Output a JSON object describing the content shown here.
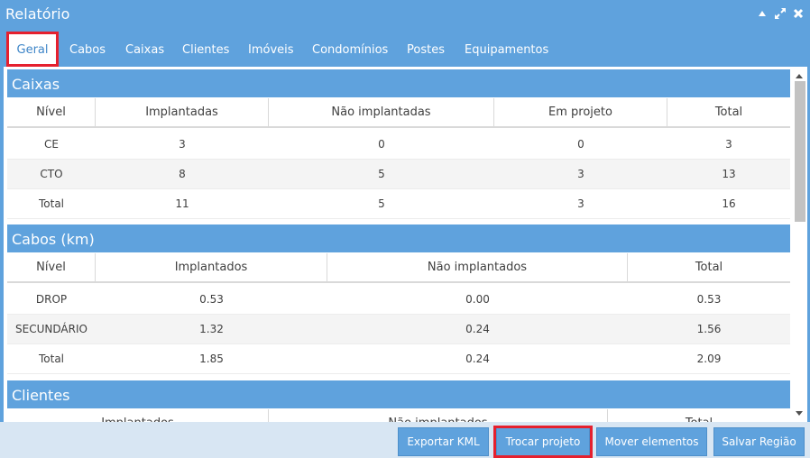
{
  "window": {
    "title": "Relatório"
  },
  "tabs": [
    {
      "label": "Geral",
      "active": true
    },
    {
      "label": "Cabos"
    },
    {
      "label": "Caixas"
    },
    {
      "label": "Clientes"
    },
    {
      "label": "Imóveis"
    },
    {
      "label": "Condomínios"
    },
    {
      "label": "Postes"
    },
    {
      "label": "Equipamentos"
    }
  ],
  "caixas": {
    "title": "Caixas",
    "headers": [
      "Nível",
      "Implantadas",
      "Não implantadas",
      "Em projeto",
      "Total"
    ],
    "rows": [
      [
        "CE",
        "3",
        "0",
        "0",
        "3"
      ],
      [
        "CTO",
        "8",
        "5",
        "3",
        "13"
      ],
      [
        "Total",
        "11",
        "5",
        "3",
        "16"
      ]
    ]
  },
  "cabos": {
    "title": "Cabos (km)",
    "headers": [
      "Nível",
      "Implantados",
      "Não implantados",
      "Total"
    ],
    "rows": [
      [
        "DROP",
        "0.53",
        "0.00",
        "0.53"
      ],
      [
        "SECUNDÁRIO",
        "1.32",
        "0.24",
        "1.56"
      ],
      [
        "Total",
        "1.85",
        "0.24",
        "2.09"
      ]
    ]
  },
  "clientes": {
    "title": "Clientes",
    "headers": [
      "",
      "Implantados",
      "Não implantados",
      "Total"
    ]
  },
  "footer": {
    "export_kml": "Exportar KML",
    "switch_project": "Trocar projeto",
    "move_elements": "Mover elementos",
    "save_region": "Salvar Região"
  },
  "colors": {
    "accent": "#5fa2dd",
    "highlight": "#e5202e"
  },
  "icons": [
    "collapse-icon",
    "expand-icon",
    "close-icon",
    "scroll-up-icon",
    "scroll-down-icon"
  ]
}
